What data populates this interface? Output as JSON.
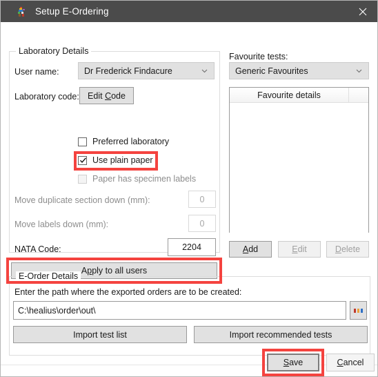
{
  "window": {
    "title": "Setup E-Ordering",
    "icon": "app-runner-icon",
    "close_label": "✕",
    "titlebar_color": "#4b4b4b",
    "accent_annotation_color": "#f4433f"
  },
  "lab_group": {
    "legend": "Laboratory Details",
    "user_name_label": "User name:",
    "user_name_value": "Dr Frederick Findacure",
    "lab_code_label": "Laboratory code:",
    "edit_code_button": "Edit Code",
    "edit_code_accel": "C",
    "checkboxes": [
      {
        "label": "Preferred laboratory",
        "checked": false,
        "disabled": false,
        "highlighted": false
      },
      {
        "label": "Use plain paper",
        "checked": true,
        "disabled": false,
        "highlighted": true
      },
      {
        "label": "Paper has specimen labels",
        "checked": false,
        "disabled": true,
        "highlighted": false
      }
    ],
    "move_duplicate_label": "Move duplicate section down (mm):",
    "move_duplicate_value": "0",
    "move_labels_label": "Move labels down (mm):",
    "move_labels_value": "0",
    "nata_label": "NATA Code:",
    "nata_value": "2204",
    "apply_button": "Apply to all users",
    "apply_accel": "p"
  },
  "favourites": {
    "section_label": "Favourite tests:",
    "selected": "Generic Favourites",
    "list_columns": [
      "Favourite details",
      ""
    ],
    "list_rows": [],
    "buttons": [
      {
        "label": "Add",
        "accel": "A",
        "disabled": false
      },
      {
        "label": "Edit",
        "accel": "E",
        "disabled": true
      },
      {
        "label": "Delete",
        "accel": "D",
        "disabled": true
      }
    ]
  },
  "eorder_group": {
    "legend": "E-Order Details",
    "path_prompt": "Enter the path where the exported orders are to be created:",
    "path_value": "C:\\healius\\order\\out\\",
    "browse_button": "...",
    "import_test_list_button": "Import test list",
    "import_recommended_button": "Import recommended tests"
  },
  "footer": {
    "save_button": "Save",
    "save_accel": "S",
    "cancel_button": "Cancel",
    "cancel_accel": "C"
  }
}
